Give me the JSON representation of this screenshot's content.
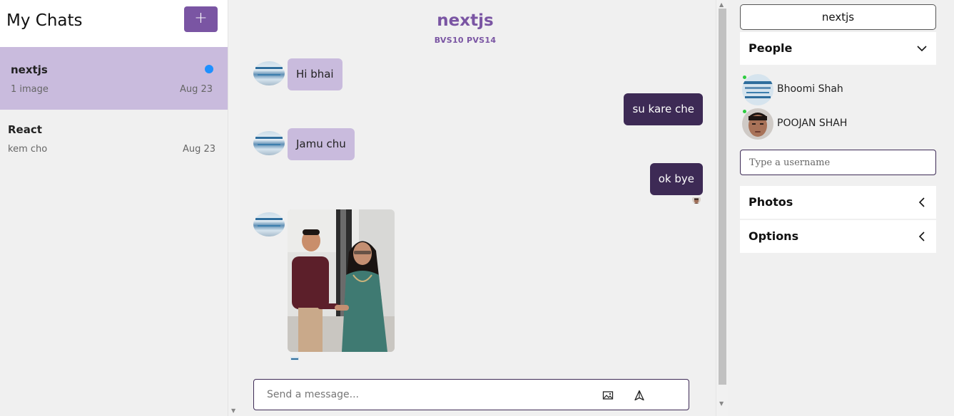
{
  "sidebar": {
    "title": "My Chats",
    "new_chat_label": "+",
    "chats": [
      {
        "name": "nextjs",
        "preview": "1 image",
        "date": "Aug 23",
        "unread": true,
        "active": true
      },
      {
        "name": "React",
        "preview": "kem cho",
        "date": "Aug 23",
        "unread": false,
        "active": false
      }
    ]
  },
  "chat": {
    "title": "nextjs",
    "subtitle": "BVS10 PVS14",
    "messages": [
      {
        "direction": "in",
        "text": "Hi bhai"
      },
      {
        "direction": "out",
        "text": "su kare che"
      },
      {
        "direction": "in",
        "text": "Jamu chu"
      },
      {
        "direction": "out",
        "text": "ok bye"
      }
    ],
    "composer_placeholder": "Send a message...",
    "icons": {
      "attach": "image-icon",
      "send": "send-icon"
    }
  },
  "right_panel": {
    "chat_name": "nextjs",
    "people_label": "People",
    "people": [
      {
        "name": "Bhoomi Shah",
        "online": true
      },
      {
        "name": "POOJAN SHAH",
        "online": true
      }
    ],
    "username_placeholder": "Type a username",
    "photos_label": "Photos",
    "options_label": "Options"
  },
  "colors": {
    "accent": "#7a55a3",
    "incoming_bubble": "#c9bbdd",
    "outgoing_bubble": "#3d2a55",
    "unread_dot": "#1e90ff"
  }
}
